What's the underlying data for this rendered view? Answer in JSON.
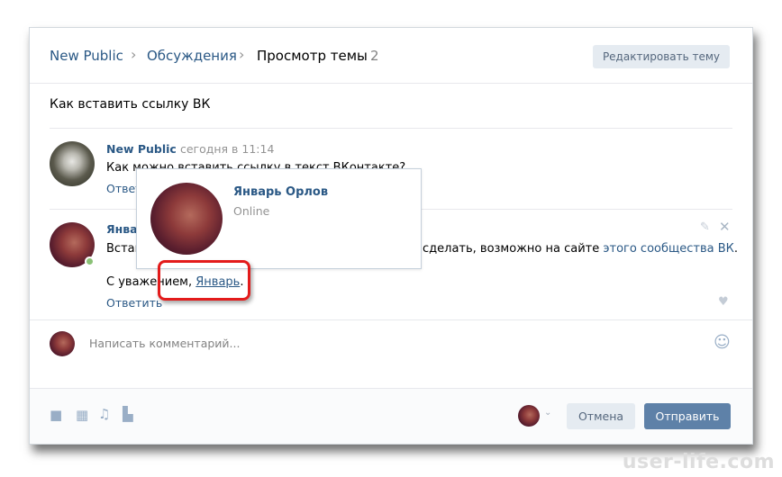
{
  "breadcrumb": {
    "items": [
      "New Public",
      "Обсуждения",
      "Просмотр темы"
    ],
    "count": "2",
    "separator": "›"
  },
  "edit_button": "Редактировать тему",
  "topic_title": "Как вставить ссылку ВК",
  "comments": [
    {
      "author": "New Public",
      "date": "сегодня в 11:14",
      "text": "Как можно вставить ссылку в текст ВКонтакте?",
      "reply": "Ответить"
    },
    {
      "author": "Январь",
      "text_start": "Встав",
      "text_end": "сделать, возможно на сайте ",
      "link": "этого сообщества ВК",
      "period": ".",
      "signature_prefix": "С уважением, ",
      "signature_link": "Январь",
      "signature_suffix": ".",
      "reply": "Ответить",
      "online": true
    }
  ],
  "popup": {
    "name": "Январь Орлов",
    "status": "Online"
  },
  "composer": {
    "placeholder": "Написать комментарий...",
    "cancel": "Отмена",
    "send": "Отправить"
  },
  "icons": [
    "camera-icon",
    "video-icon",
    "music-icon",
    "document-icon",
    "smile-icon",
    "edit-icon",
    "close-icon",
    "like-icon"
  ],
  "colors": {
    "link": "#2a5885",
    "send_button": "#5e81a8",
    "highlight": "#e31b1b",
    "online": "#8ac176"
  },
  "watermark": "user-life.com"
}
